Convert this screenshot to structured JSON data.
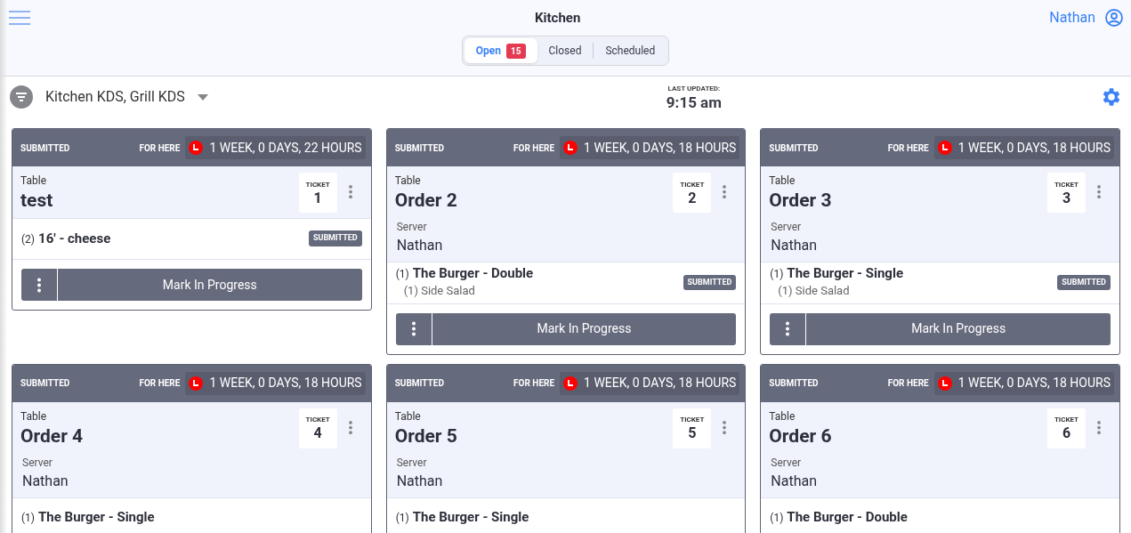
{
  "header": {
    "title": "Kitchen",
    "user": "Nathan"
  },
  "tabs": [
    {
      "label": "Open",
      "badge": "15",
      "selected": true
    },
    {
      "label": "Closed",
      "selected": false
    },
    {
      "label": "Scheduled",
      "selected": false
    }
  ],
  "toolbar": {
    "filter": "Kitchen KDS, Grill KDS",
    "updated_label": "LAST UPDATED:",
    "updated_time": "9:15 am"
  },
  "orders": [
    {
      "status": "SUBMITTED",
      "dining": "FOR HERE",
      "elapsed": "1 WEEK, 0 DAYS, 22 HOURS",
      "table_label": "Table",
      "name": "test",
      "ticket_label": "TICKET",
      "ticket": "1",
      "items": [
        {
          "qty": "(2)",
          "name": "16' - cheese",
          "badge": "SUBMITTED"
        }
      ],
      "action": "Mark In Progress"
    },
    {
      "status": "SUBMITTED",
      "dining": "FOR HERE",
      "elapsed": "1 WEEK, 0 DAYS, 18 HOURS",
      "table_label": "Table",
      "name": "Order 2",
      "ticket_label": "TICKET",
      "ticket": "2",
      "server_label": "Server",
      "server": "Nathan",
      "items": [
        {
          "qty": "(1)",
          "name": "The Burger - Double",
          "badge": "SUBMITTED",
          "modifiers": [
            "(1) Side Salad"
          ]
        }
      ],
      "action": "Mark In Progress"
    },
    {
      "status": "SUBMITTED",
      "dining": "FOR HERE",
      "elapsed": "1 WEEK, 0 DAYS, 18 HOURS",
      "table_label": "Table",
      "name": "Order 3",
      "ticket_label": "TICKET",
      "ticket": "3",
      "server_label": "Server",
      "server": "Nathan",
      "items": [
        {
          "qty": "(1)",
          "name": "The Burger - Single",
          "badge": "SUBMITTED",
          "modifiers": [
            "(1) Side Salad"
          ]
        }
      ],
      "action": "Mark In Progress"
    },
    {
      "status": "SUBMITTED",
      "dining": "FOR HERE",
      "elapsed": "1 WEEK, 0 DAYS, 18 HOURS",
      "table_label": "Table",
      "name": "Order 4",
      "ticket_label": "TICKET",
      "ticket": "4",
      "server_label": "Server",
      "server": "Nathan",
      "items": [
        {
          "qty": "(1)",
          "name": "The Burger - Single"
        }
      ]
    },
    {
      "status": "SUBMITTED",
      "dining": "FOR HERE",
      "elapsed": "1 WEEK, 0 DAYS, 18 HOURS",
      "table_label": "Table",
      "name": "Order 5",
      "ticket_label": "TICKET",
      "ticket": "5",
      "server_label": "Server",
      "server": "Nathan",
      "items": [
        {
          "qty": "(1)",
          "name": "The Burger - Single"
        }
      ]
    },
    {
      "status": "SUBMITTED",
      "dining": "FOR HERE",
      "elapsed": "1 WEEK, 0 DAYS, 18 HOURS",
      "table_label": "Table",
      "name": "Order 6",
      "ticket_label": "TICKET",
      "ticket": "6",
      "server_label": "Server",
      "server": "Nathan",
      "items": [
        {
          "qty": "(1)",
          "name": "The Burger - Double"
        }
      ]
    }
  ]
}
